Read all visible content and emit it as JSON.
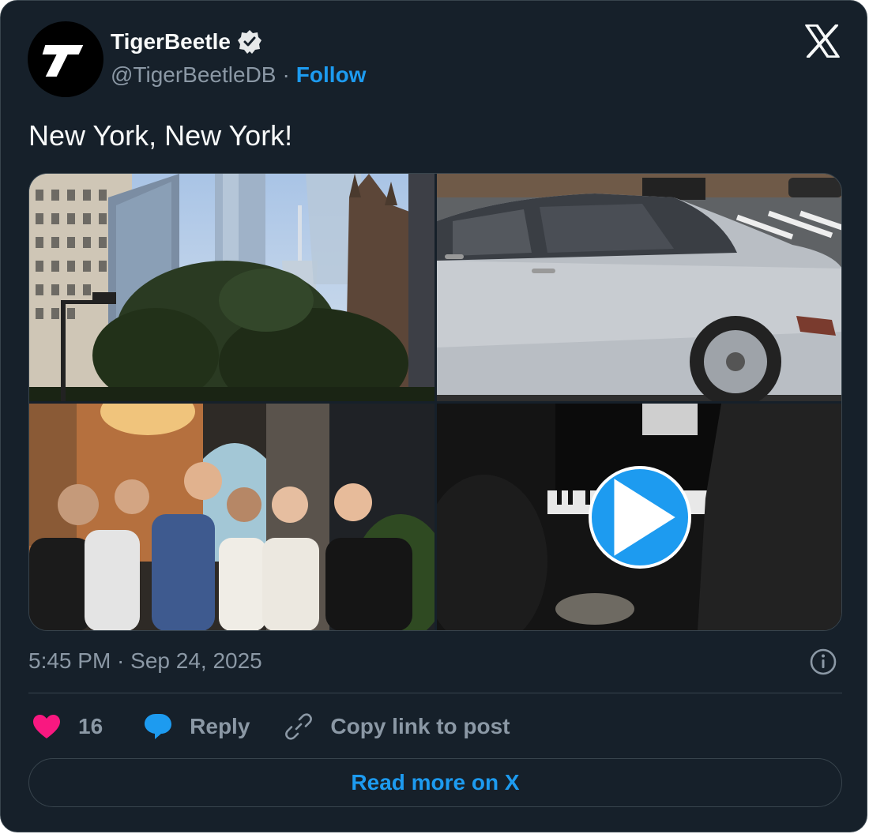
{
  "author": {
    "display_name": "TigerBeetle",
    "handle": "@TigerBeetleDB",
    "follow_label": "Follow",
    "avatar_letter": "T",
    "verified": true
  },
  "tweet": {
    "text": "New York, New York!",
    "timestamp": "5:45 PM · Sep 24, 2025",
    "media": [
      {
        "kind": "photo",
        "description_icon": "city-buildings-photo"
      },
      {
        "kind": "photo",
        "description_icon": "silver-car-photo"
      },
      {
        "kind": "photo",
        "description_icon": "group-photo"
      },
      {
        "kind": "video",
        "description_icon": "piano-video"
      }
    ]
  },
  "actions": {
    "like_count": "16",
    "reply_label": "Reply",
    "copy_label": "Copy link to post"
  },
  "footer": {
    "read_more_label": "Read more on X"
  },
  "colors": {
    "background": "#16202a",
    "accent": "#1d9bf0",
    "like": "#f91880",
    "text": "#f7f9f9",
    "muted": "#8b98a5",
    "border": "#38444d"
  }
}
